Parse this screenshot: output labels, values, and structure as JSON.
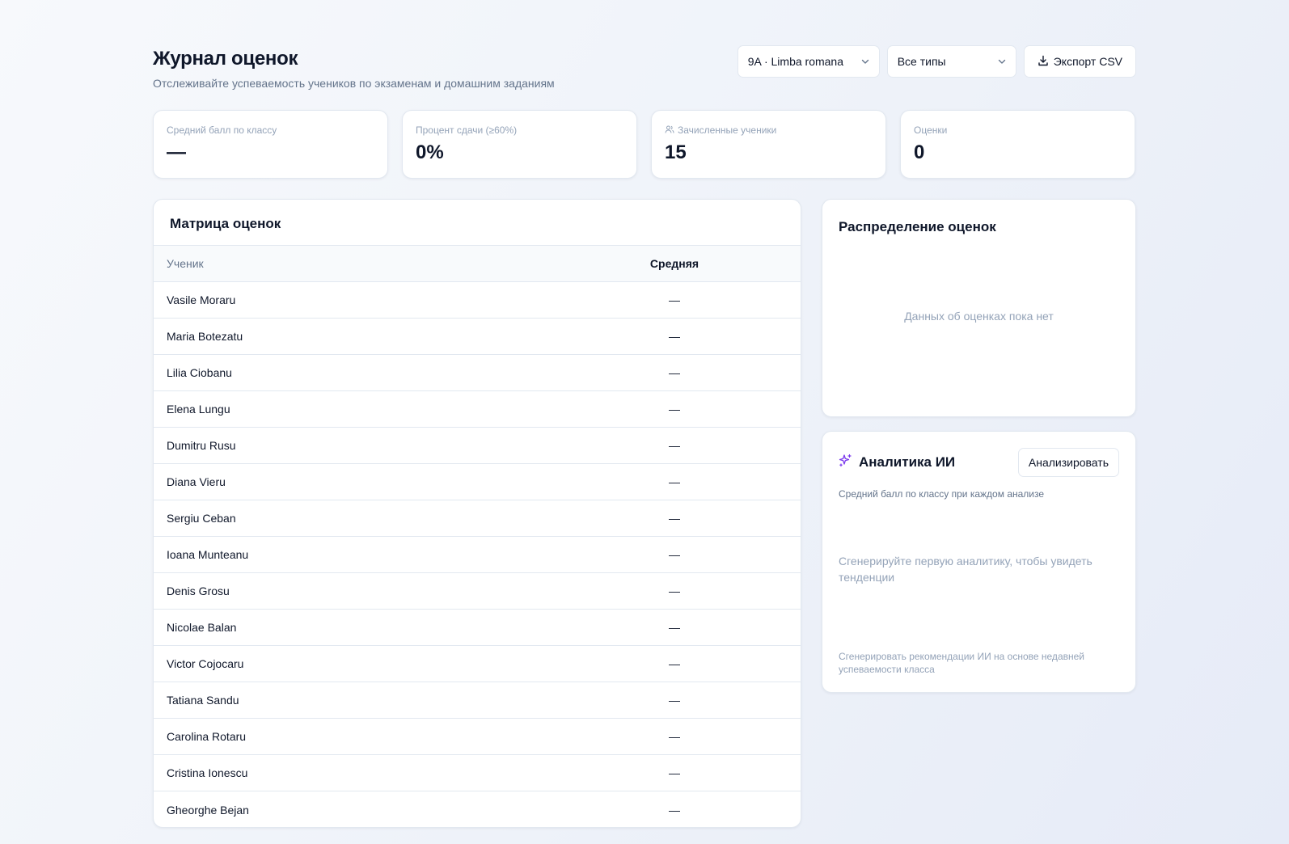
{
  "header": {
    "title": "Журнал оценок",
    "subtitle": "Отслеживайте успеваемость учеников по экзаменам и домашним заданиям",
    "class_select": "9A · Limba romana",
    "type_select": "Все типы",
    "export_label": "Экспорт CSV"
  },
  "stats": [
    {
      "label": "Средний балл по классу",
      "value": "—"
    },
    {
      "label": "Процент сдачи (≥60%)",
      "value": "0%"
    },
    {
      "label": "Зачисленные ученики",
      "value": "15"
    },
    {
      "label": "Оценки",
      "value": "0"
    }
  ],
  "matrix": {
    "title": "Матрица оценок",
    "col_student": "Ученик",
    "col_avg": "Средняя",
    "rows": [
      {
        "name": "Vasile Moraru",
        "avg": "—"
      },
      {
        "name": "Maria Botezatu",
        "avg": "—"
      },
      {
        "name": "Lilia Ciobanu",
        "avg": "—"
      },
      {
        "name": "Elena Lungu",
        "avg": "—"
      },
      {
        "name": "Dumitru Rusu",
        "avg": "—"
      },
      {
        "name": "Diana Vieru",
        "avg": "—"
      },
      {
        "name": "Sergiu Ceban",
        "avg": "—"
      },
      {
        "name": "Ioana Munteanu",
        "avg": "—"
      },
      {
        "name": "Denis Grosu",
        "avg": "—"
      },
      {
        "name": "Nicolae Balan",
        "avg": "—"
      },
      {
        "name": "Victor Cojocaru",
        "avg": "—"
      },
      {
        "name": "Tatiana Sandu",
        "avg": "—"
      },
      {
        "name": "Carolina Rotaru",
        "avg": "—"
      },
      {
        "name": "Cristina Ionescu",
        "avg": "—"
      },
      {
        "name": "Gheorghe Bejan",
        "avg": "—"
      }
    ]
  },
  "distribution": {
    "title": "Распределение оценок",
    "empty": "Данных об оценках пока нет"
  },
  "ai": {
    "title": "Аналитика ИИ",
    "analyze_label": "Анализировать",
    "subtitle": "Средний балл по классу при каждом анализе",
    "empty": "Сгенерируйте первую аналитику, чтобы увидеть тенденции",
    "footer": "Сгенерировать рекомендации ИИ на основе недавней успеваемости класса"
  },
  "colors": {
    "accent": "#7c3aed",
    "muted": "#94a3b8",
    "border": "#e2e8f0"
  }
}
